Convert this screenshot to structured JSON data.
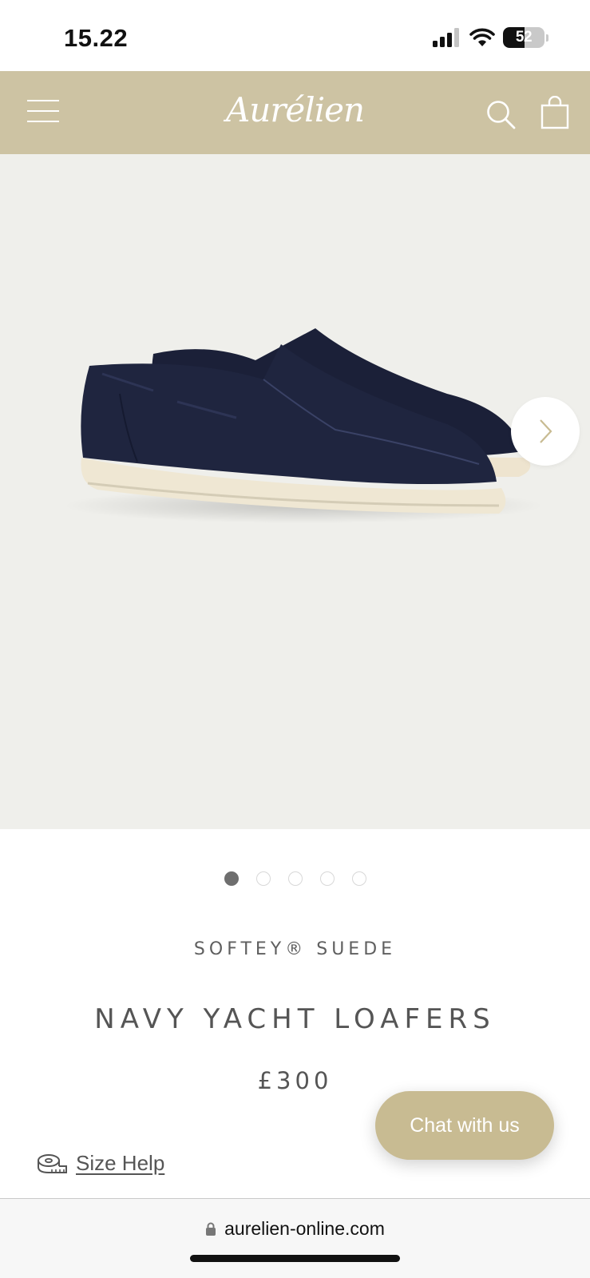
{
  "status_bar": {
    "time": "15.22",
    "battery_level": "52",
    "battery_percent": 52
  },
  "header": {
    "logo_text": "Aurélien",
    "background_color": "#cdc3a3",
    "icons": [
      "menu-icon",
      "search-icon",
      "shopping-bag-icon"
    ]
  },
  "gallery": {
    "image_description_icon": "navy-suede-loafers-image",
    "next_icon": "chevron-right-icon",
    "slide_count": 5,
    "active_slide": 1
  },
  "product": {
    "collection": "SOFTEY® SUEDE",
    "title": "NAVY YACHT LOAFERS",
    "price": "£300"
  },
  "size_help": {
    "label": "Size Help",
    "icon": "measuring-tape-icon"
  },
  "chat": {
    "label": "Chat with us",
    "color": "#c8bb92"
  },
  "browser": {
    "url": "aurelien-online.com",
    "lock_icon": "lock-icon"
  }
}
